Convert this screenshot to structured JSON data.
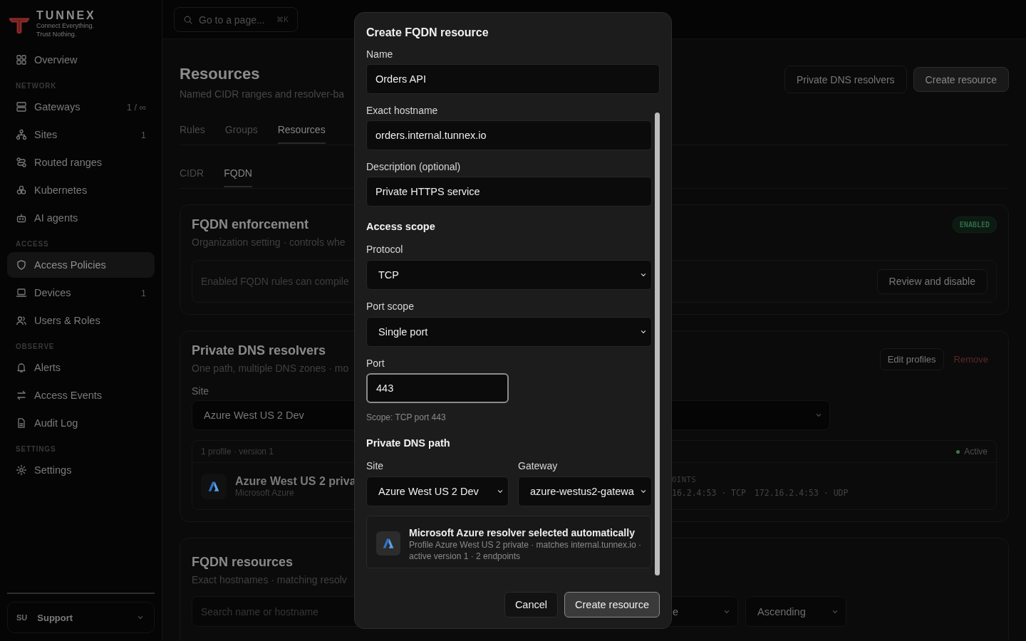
{
  "brand": {
    "name": "TUNNEX",
    "tagline": [
      "Connect Everything.",
      "Trust Nothing."
    ]
  },
  "search": {
    "placeholder": "Go to a page...",
    "shortcut": "⌘K"
  },
  "sidebar": {
    "sections": [
      {
        "items": [
          {
            "label": "Overview",
            "selected": false
          }
        ]
      },
      {
        "heading": "NETWORK",
        "items": [
          {
            "label": "Gateways",
            "count": "1 / ∞",
            "selected": false
          },
          {
            "label": "Sites",
            "count": "1",
            "selected": false
          },
          {
            "label": "Routed ranges",
            "selected": false
          },
          {
            "label": "Kubernetes",
            "selected": false
          },
          {
            "label": "AI agents",
            "selected": false
          }
        ]
      },
      {
        "heading": "ACCESS",
        "items": [
          {
            "label": "Access Policies",
            "selected": true
          },
          {
            "label": "Devices",
            "count": "1",
            "selected": false
          },
          {
            "label": "Users & Roles",
            "selected": false
          }
        ]
      },
      {
        "heading": "OBSERVE",
        "items": [
          {
            "label": "Alerts",
            "selected": false
          },
          {
            "label": "Access Events",
            "selected": false
          },
          {
            "label": "Audit Log",
            "selected": false
          }
        ]
      },
      {
        "heading": "SETTINGS",
        "items": [
          {
            "label": "Settings",
            "selected": false
          }
        ]
      }
    ],
    "user": {
      "initials": "SU",
      "name": "Support"
    }
  },
  "page": {
    "title": "Resources",
    "subtitle": "Named CIDR ranges and resolver-ba",
    "buttons": [
      "Private DNS resolvers",
      "Create resource"
    ],
    "tabs": [
      {
        "label": "Rules",
        "selected": false
      },
      {
        "label": "Groups",
        "selected": false
      },
      {
        "label": "Resources",
        "selected": true
      }
    ],
    "subtabs": [
      {
        "label": "CIDR",
        "selected": false
      },
      {
        "label": "FQDN",
        "selected": true
      }
    ]
  },
  "enforcement": {
    "title": "FQDN enforcement",
    "subtitle": "Organization setting · controls whe",
    "badge": "ENABLED",
    "notice": "Enabled FQDN rules can compile",
    "button": "Review and disable"
  },
  "resolvers": {
    "title": "Private DNS resolvers",
    "subtitle": "One path, multiple DNS zones · mo",
    "buttons": [
      "Edit profiles",
      "Remove"
    ],
    "site_label": "Site",
    "site_value": "Azure West US 2 Dev",
    "profile": {
      "header": "1 profile · version 1",
      "status": "Active",
      "color": "#3d7a52",
      "name": "Azure West US 2 priva",
      "provider": "Microsoft Azure",
      "endpoints_label": "OINTS",
      "endpoints": [
        "16.2.4:53 · TCP",
        "172.16.2.4:53 · UDP"
      ]
    }
  },
  "fqdn_resources": {
    "title": "FQDN resources",
    "subtitle": "Exact hostnames · matching resolv",
    "search_placeholder": "Search name or hostname",
    "selects": [
      "e",
      "Ascending"
    ]
  },
  "modal": {
    "title": "Create FQDN resource",
    "name": {
      "label": "Name",
      "value": "Orders API"
    },
    "body": [
      {
        "kind": "input",
        "label": "Exact hostname",
        "value": "orders.internal.tunnex.io",
        "focused": false
      },
      {
        "kind": "input",
        "label": "Description (optional)",
        "value": "Private HTTPS service",
        "focused": false
      },
      {
        "kind": "heading",
        "text": "Access scope"
      },
      {
        "kind": "select",
        "label": "Protocol",
        "value": "TCP"
      },
      {
        "kind": "select",
        "label": "Port scope",
        "value": "Single port"
      },
      {
        "kind": "short_input",
        "label": "Port",
        "value": "443",
        "focused": true
      },
      {
        "kind": "hint",
        "text": "Scope: TCP port 443"
      },
      {
        "kind": "heading",
        "text": "Private DNS path"
      },
      {
        "kind": "pair",
        "fields": [
          {
            "label": "Site",
            "value": "Azure West US 2 Dev"
          },
          {
            "label": "Gateway",
            "value": "azure-westus2-gatewa"
          }
        ]
      },
      {
        "kind": "info",
        "title": "Microsoft Azure resolver selected automatically",
        "detail": "Profile Azure West US 2 private · matches internal.tunnex.io · active version 1 · 2 endpoints"
      }
    ],
    "buttons": [
      {
        "label": "Cancel",
        "primary": false
      },
      {
        "label": "Create resource",
        "primary": true
      }
    ]
  }
}
